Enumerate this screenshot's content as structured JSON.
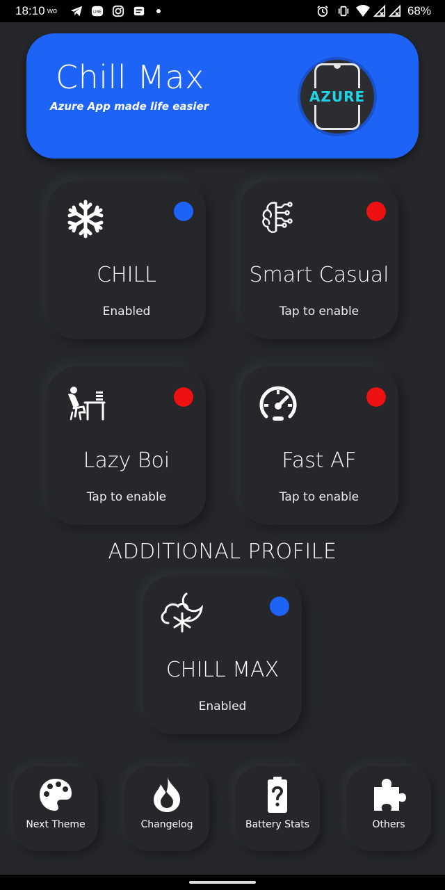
{
  "status_bar": {
    "time": "18:10",
    "carrier": "wo",
    "battery": "68%",
    "icons": [
      "telegram-icon",
      "line-icon",
      "instagram-icon",
      "news-icon",
      "dot-icon",
      "alarm-icon",
      "vibrate-icon",
      "wifi-icon",
      "signal-icon",
      "signal-icon"
    ]
  },
  "header": {
    "title": "Chill Max",
    "subtitle": "Azure App made life easier",
    "logo_text": "AZURE",
    "color": "#1d63f5"
  },
  "profiles": [
    {
      "name": "CHILL",
      "state": "Enabled",
      "icon": "snowflake-icon",
      "indicator": "#1d63f5"
    },
    {
      "name": "Smart Casual",
      "state": "Tap to enable",
      "icon": "brain-circuit-icon",
      "indicator": "#ee1111"
    },
    {
      "name": "Lazy Boi",
      "state": "Tap to enable",
      "icon": "lazy-desk-icon",
      "indicator": "#ee1111"
    },
    {
      "name": "Fast AF",
      "state": "Tap to enable",
      "icon": "speedometer-icon",
      "indicator": "#ee1111"
    }
  ],
  "additional": {
    "title": "ADDITIONAL PROFILE",
    "profile": {
      "name": "CHILL MAX",
      "state": "Enabled",
      "icon": "cloud-snow-moon-icon",
      "indicator": "#1d63f5"
    }
  },
  "nav": [
    {
      "label": "Next Theme",
      "icon": "palette-icon"
    },
    {
      "label": "Changelog",
      "icon": "flame-icon"
    },
    {
      "label": "Battery Stats",
      "icon": "battery-question-icon"
    },
    {
      "label": "Others",
      "icon": "puzzle-icon"
    }
  ]
}
